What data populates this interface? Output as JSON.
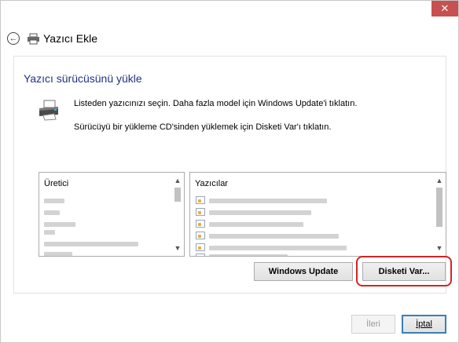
{
  "window": {
    "close_glyph": "✕"
  },
  "header": {
    "back_icon": "back-arrow-icon",
    "title": "Yazıcı Ekle"
  },
  "main": {
    "heading": "Yazıcı sürücüsünü yükle",
    "instructions": [
      "Listeden yazıcınızı seçin. Daha fazla model için Windows Update'i tıklatın.",
      "Sürücüyü bir yükleme CD'sinden yüklemek için Disketi Var'ı tıklatın."
    ]
  },
  "lists": {
    "manufacturer": {
      "header": "Üretici",
      "items": [
        "",
        "",
        "",
        "",
        "",
        ""
      ]
    },
    "printers": {
      "header": "Yazıcılar",
      "items": [
        "",
        "",
        "",
        "",
        "",
        ""
      ]
    }
  },
  "buttons": {
    "windows_update": "Windows Update",
    "have_disk": "Disketi Var...",
    "next": "İleri",
    "cancel": "İptal"
  },
  "colors": {
    "heading": "#1e3287",
    "close": "#c75050",
    "highlight": "#d42424"
  }
}
